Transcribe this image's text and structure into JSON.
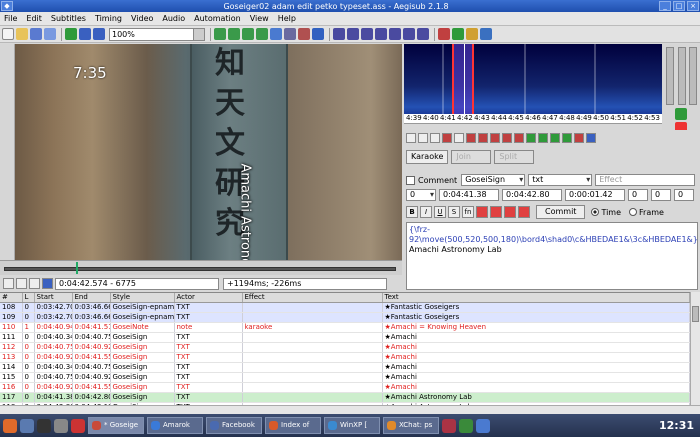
{
  "window": {
    "title": "Goseiger02 adam edit petko typeset.ass - Aegisub 2.1.8"
  },
  "menu": [
    "File",
    "Edit",
    "Subtitles",
    "Timing",
    "Video",
    "Audio",
    "Automation",
    "View",
    "Help"
  ],
  "toolbar": {
    "zoom_value": "100%"
  },
  "video": {
    "clock_text": "7:35",
    "sign_kanji": "知天文研究",
    "sign_subtitle": "Amachi Astronomy Lab"
  },
  "video_controls": {
    "time_frame": "0:04:42.574 - 6775",
    "offset": "+1194ms; -226ms"
  },
  "audio": {
    "scale_labels": [
      "4:39",
      "4:40",
      "4:41",
      "4:42",
      "4:43",
      "4:44",
      "4:45",
      "4:46",
      "4:47",
      "4:48",
      "4:49",
      "4:50",
      "4:51",
      "4:52",
      "4:53"
    ],
    "karaoke_label": "Karaoke",
    "join_label": "Join",
    "split_label": "Split"
  },
  "editor": {
    "comment_label": "Comment",
    "style": "GoseiSign",
    "actor": "txt",
    "effect_placeholder": "Effect",
    "layer": "0",
    "start": "0:04:41.38",
    "end": "0:04:42.80",
    "duration": "0:00:01.42",
    "margin_l": "0",
    "margin_r": "0",
    "margin_v": "0",
    "commit_label": "Commit",
    "time_label": "Time",
    "frame_label": "Frame",
    "text_tags": "{\\frz-92\\move(500,520,500,180)\\bord4\\shad0\\c&HBEDAE1&\\3c&HBEDAE1&}",
    "text_body": "Amachi Astronomy Lab"
  },
  "grid": {
    "headers": [
      "#",
      "L",
      "Start",
      "End",
      "Style",
      "Actor",
      "Effect",
      "Text"
    ],
    "rows": [
      {
        "kind": "blue",
        "cells": [
          "108",
          "0",
          "0:03:42.70",
          "0:03:46.66",
          "GoseiSign-epname",
          "TXT",
          "",
          "★Fantastic Goseigers"
        ]
      },
      {
        "kind": "blue",
        "cells": [
          "109",
          "0",
          "0:03:42.70",
          "0:03:46.66",
          "GoseiSign-epname",
          "TXT",
          "",
          "★Fantastic Goseigers"
        ]
      },
      {
        "kind": "red",
        "cells": [
          "110",
          "1",
          "0:04:40.94",
          "0:04:41.51",
          "GoseiNote",
          "note",
          "karaoke",
          "★Amachi = Knowing Heaven"
        ]
      },
      {
        "kind": "plain",
        "cells": [
          "111",
          "0",
          "0:04:40.34",
          "0:04:40.75",
          "GoseiSign",
          "TXT",
          "",
          "★Amachi"
        ]
      },
      {
        "kind": "red",
        "cells": [
          "112",
          "0",
          "0:04:40.75",
          "0:04:40.92",
          "GoseiSign",
          "TXT",
          "",
          "★Amachi"
        ]
      },
      {
        "kind": "red",
        "cells": [
          "113",
          "0",
          "0:04:40.92",
          "0:04:41.55",
          "GoseiSign",
          "TXT",
          "",
          "★Amachi"
        ]
      },
      {
        "kind": "plain",
        "cells": [
          "114",
          "0",
          "0:04:40.34",
          "0:04:40.75",
          "GoseiSign",
          "TXT",
          "",
          "★Amachi"
        ]
      },
      {
        "kind": "plain",
        "cells": [
          "115",
          "0",
          "0:04:40.75",
          "0:04:40.92",
          "GoseiSign",
          "TXT",
          "",
          "★Amachi"
        ]
      },
      {
        "kind": "red",
        "cells": [
          "116",
          "0",
          "0:04:40.92",
          "0:04:41.55",
          "GoseiSign",
          "TXT",
          "",
          "★Amachi"
        ]
      },
      {
        "kind": "green",
        "cells": [
          "117",
          "0",
          "0:04:41.38",
          "0:04:42.80",
          "GoseiSign",
          "TXT",
          "",
          "★Amachi Astronomy Lab"
        ]
      },
      {
        "kind": "plain",
        "cells": [
          "118",
          "0",
          "0:04:42.80",
          "0:04:43.13",
          "GoseiSign",
          "TXT",
          "",
          "★Amachi Astronomy Lab"
        ]
      }
    ]
  },
  "taskbar": {
    "tasks": [
      {
        "label": "* Goseige",
        "icon": "aegisub-icon",
        "color": "#c84a3a",
        "active": true
      },
      {
        "label": "Amarok",
        "icon": "amarok-icon",
        "color": "#3a7ad8",
        "active": false
      },
      {
        "label": "Facebook",
        "icon": "browser-icon",
        "color": "#4a6ab0",
        "active": false
      },
      {
        "label": "Index of",
        "icon": "browser-icon",
        "color": "#d85a2a",
        "active": false
      },
      {
        "label": "WinXP [",
        "icon": "vm-icon",
        "color": "#3a8ad0",
        "active": false
      },
      {
        "label": "XChat: ps",
        "icon": "chat-icon",
        "color": "#e08a2a",
        "active": false
      }
    ],
    "clock": "12:31"
  }
}
